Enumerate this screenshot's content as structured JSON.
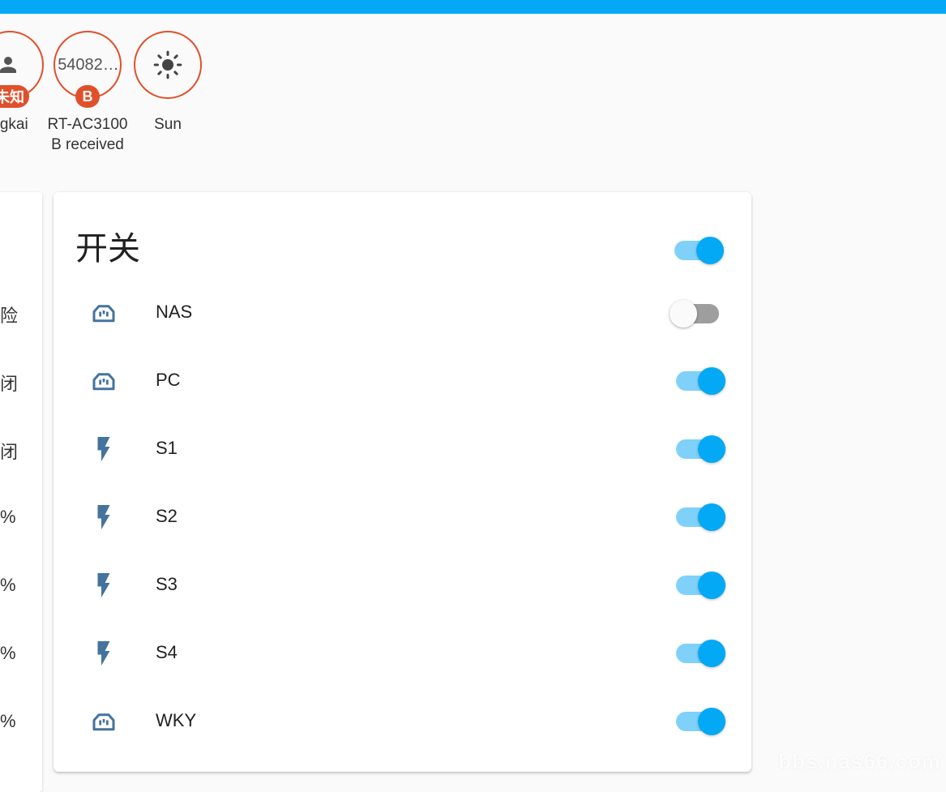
{
  "badges": [
    {
      "icon": "person-icon",
      "tag": "未知",
      "name": "ngkai"
    },
    {
      "value": "54082…",
      "tag": "B",
      "name": "RT-AC3100 B received"
    },
    {
      "icon": "sun-icon",
      "name": "Sun"
    }
  ],
  "left_card": {
    "fragments": [
      "险",
      "闭",
      "闭",
      "%",
      "%",
      "%",
      "%"
    ]
  },
  "switch_card": {
    "title": "开关",
    "master_on": true,
    "items": [
      {
        "label": "NAS",
        "icon": "power-socket-icon",
        "on": false
      },
      {
        "label": "PC",
        "icon": "power-socket-icon",
        "on": true
      },
      {
        "label": "S1",
        "icon": "flash-icon",
        "on": true
      },
      {
        "label": "S2",
        "icon": "flash-icon",
        "on": true
      },
      {
        "label": "S3",
        "icon": "flash-icon",
        "on": true
      },
      {
        "label": "S4",
        "icon": "flash-icon",
        "on": true
      },
      {
        "label": "WKY",
        "icon": "power-socket-icon",
        "on": true
      }
    ]
  },
  "watermark": "bbs.nas66.com",
  "colors": {
    "accent": "#03a9f4",
    "badge_border": "#e0502a",
    "icon": "#44739e"
  }
}
